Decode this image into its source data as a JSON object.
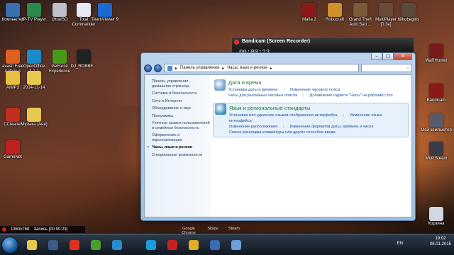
{
  "desktop": {
    "icons_left": [
      {
        "label": "Компьютер",
        "color": "#3a6fb0"
      },
      {
        "label": "IP-TV Player",
        "color": "#2a8a4a"
      },
      {
        "label": "UltraISO",
        "color": "#c0c0c8"
      },
      {
        "label": "Total Commander",
        "color": "#e8e8f0"
      },
      {
        "label": "TeamViewer 9",
        "color": "#1a6ad0"
      },
      {
        "label": "avast! Free Antivirus",
        "color": "#e06020"
      },
      {
        "label": "OpenOffice 4.1.1",
        "color": "#1a8ac8"
      },
      {
        "label": "GeForce Experience",
        "color": "#4a9a1a"
      },
      {
        "label": "DJ_ROBBE...",
        "color": "#222222"
      },
      {
        "label": "AIMP3",
        "color": "#e8c040"
      },
      {
        "label": "2014-12-14",
        "color": "#e8c850"
      },
      {
        "label": "CCleaner",
        "color": "#c03020"
      },
      {
        "label": "Музыка (Аня)",
        "color": "#e8c850"
      },
      {
        "label": "GameNet",
        "color": "#c02020"
      }
    ],
    "icons_top_right": [
      {
        "label": "Mafia 2",
        "color": "#8a1a1a"
      },
      {
        "label": "Robocraft",
        "color": "#d09030"
      },
      {
        "label": "Grand Theft Auto San ...",
        "color": "#7a5a3a"
      },
      {
        "label": "MultiPlayer [0.3e]",
        "color": "#6a4a3a"
      },
      {
        "label": "bilbobegins",
        "color": "#5a4a3a"
      }
    ],
    "icons_right": [
      {
        "label": "WaRHunter",
        "color": "#7a1a1a"
      },
      {
        "label": "Bandicam",
        "color": "#8a1a1a"
      },
      {
        "label": "Мой компьютер",
        "color": "#5a5a6a"
      },
      {
        "label": "Мой Steam",
        "color": "#3a3a4a"
      },
      {
        "label": "Корзина",
        "color": "#d0d8e0"
      }
    ]
  },
  "bandicam": {
    "title": "Bandicam (Screen Recorder)",
    "timer": "00:00:23"
  },
  "window": {
    "controls": {
      "minimize": "–",
      "maximize": "□",
      "close": "✕"
    },
    "breadcrumb": [
      "Панель управления",
      "Часы, язык и регион"
    ],
    "search_placeholder": "",
    "sidebar": [
      "Панель управления - домашняя страница",
      "Система и безопасность",
      "Сеть и Интернет",
      "Оборудование и звук",
      "Программы",
      "Учетные записи пользователей и семейная безопасность",
      "Оформление и персонализация",
      "Часы, язык и регион",
      "Специальные возможности"
    ],
    "current_sidebar": "Часы, язык и регион",
    "categories": [
      {
        "title": "Дата и время",
        "icon_color": "#6a9ad0",
        "links": [
          [
            "Установка даты и времени",
            "Изменение часового пояса"
          ],
          [
            "Часы для различных часовых поясов",
            "Добавление гаджета \"Часы\" на рабочий стол"
          ]
        ]
      },
      {
        "title": "Язык и региональные стандарты",
        "icon_color": "#3a8ac0",
        "links": [
          [
            "Установка или удаление языков отображения интерфейса",
            "Изменение языка интерфейса"
          ],
          [
            "Изменение расположения",
            "Изменение форматов даты, времени и чисел"
          ],
          [
            "Смена раскладки клавиатуры или других способов ввода"
          ]
        ]
      }
    ]
  },
  "recorder_bar": {
    "resolution": "1360x768",
    "status": "Запись [00:00:23]"
  },
  "taskbar": {
    "ghost_labels": [
      "Google Chrome",
      "Skype",
      "Steam"
    ],
    "lang": "EN",
    "time": "19:02",
    "date": "08.01.2015",
    "buttons": [
      {
        "name": "explorer",
        "color": "#e8c850"
      },
      {
        "name": "steam",
        "color": "#3a5a8a"
      },
      {
        "name": "yandex-browser",
        "color": "#e03020"
      },
      {
        "name": "utorrent",
        "color": "#4aa02a"
      },
      {
        "name": "media",
        "color": "#2a8ad0"
      },
      {
        "name": "skype",
        "color": "#1a9ae0"
      },
      {
        "name": "bandicam",
        "color": "#c82020"
      },
      {
        "name": "chrome",
        "color": "#e0b020"
      },
      {
        "name": "player",
        "color": "#3a6ab0"
      },
      {
        "name": "control-panel",
        "color": "#6aa0e0"
      }
    ]
  }
}
